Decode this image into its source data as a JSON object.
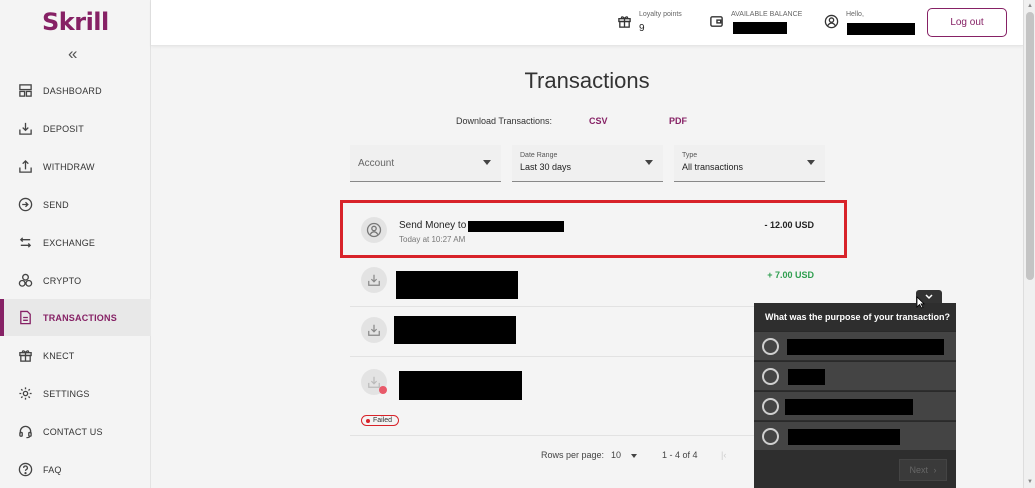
{
  "brand": {
    "logo_text": "Skrill",
    "accent": "#862165"
  },
  "sidebar": {
    "collapse_glyph": "«",
    "items": [
      {
        "label": "DASHBOARD",
        "icon": "dashboard-icon"
      },
      {
        "label": "DEPOSIT",
        "icon": "deposit-icon"
      },
      {
        "label": "WITHDRAW",
        "icon": "withdraw-icon"
      },
      {
        "label": "SEND",
        "icon": "send-icon"
      },
      {
        "label": "EXCHANGE",
        "icon": "exchange-icon"
      },
      {
        "label": "CRYPTO",
        "icon": "crypto-icon"
      },
      {
        "label": "TRANSACTIONS",
        "icon": "transactions-icon",
        "active": true
      },
      {
        "label": "KNECT",
        "icon": "gift-icon"
      },
      {
        "label": "SETTINGS",
        "icon": "gear-icon"
      },
      {
        "label": "CONTACT US",
        "icon": "headset-icon"
      },
      {
        "label": "FAQ",
        "icon": "question-icon"
      }
    ]
  },
  "header": {
    "loyalty_label": "Loyalty points",
    "loyalty_value": "9",
    "balance_label": "AVAILABLE BALANCE",
    "greeting_label": "Hello,",
    "logout_label": "Log out"
  },
  "main": {
    "title": "Transactions",
    "download_label": "Download Transactions:",
    "download_csv": "CSV",
    "download_pdf": "PDF",
    "filters": {
      "account_placeholder": "Account",
      "date_label": "Date Range",
      "date_value": "Last 30 days",
      "type_label": "Type",
      "type_value": "All transactions"
    },
    "transactions": [
      {
        "desc_prefix": "Send Money to",
        "time": "Today at 10:27 AM",
        "amount": "- 12.00 USD",
        "amount_color": "#222222"
      },
      {
        "amount": "+ 7.00 USD",
        "amount_color": "#2e9e4f"
      },
      {},
      {
        "status": "Failed"
      }
    ],
    "pagination": {
      "rows_label": "Rows per page:",
      "rows_value": "10",
      "range": "1 - 4 of 4"
    }
  },
  "survey": {
    "question": "What was the purpose of your transaction?",
    "next_label": "Next"
  },
  "colors": {
    "highlight": "#d8232a",
    "positive": "#2e9e4f"
  }
}
